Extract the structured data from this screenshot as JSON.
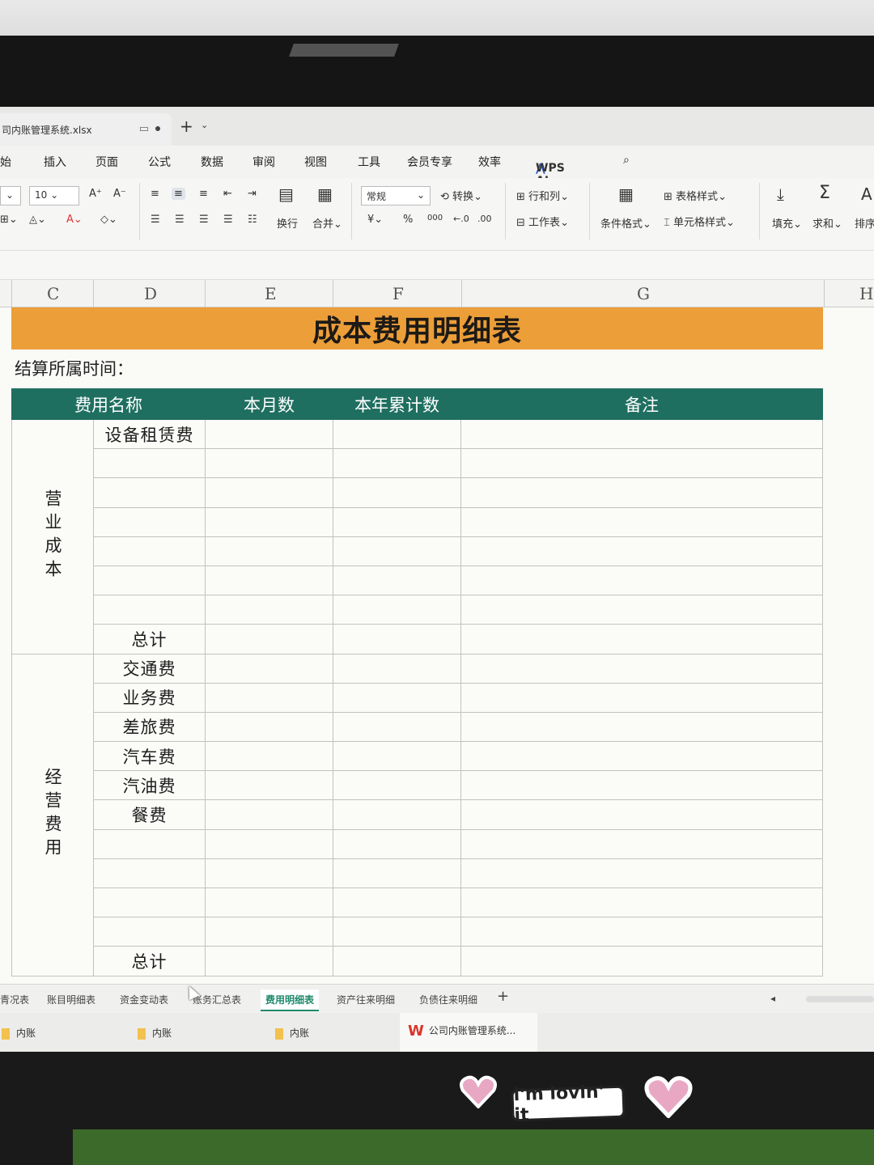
{
  "window": {
    "file_tab": "司内账管理系统.xlsx",
    "new_tab": "+"
  },
  "menu": {
    "items": [
      "始",
      "插入",
      "页面",
      "公式",
      "数据",
      "审阅",
      "视图",
      "工具",
      "会员专享",
      "效率"
    ],
    "ai_label": "WPS AI"
  },
  "ribbon": {
    "font_size": "10",
    "number_format": "常规",
    "wrap_label": "换行",
    "merge_label": "合并",
    "convert_label": "转换",
    "rowcol_label": "行和列",
    "worksheet_label": "工作表",
    "cond_format_label": "条件格式",
    "table_style_label": "表格样式",
    "cell_style_label": "单元格样式",
    "fill_label": "填充",
    "sum_label": "求和",
    "sort_label": "排序",
    "currency_symbol": "¥",
    "percent_symbol": "%",
    "thousands_symbol": "000"
  },
  "columns": [
    "C",
    "D",
    "E",
    "F",
    "G",
    "H"
  ],
  "sheet": {
    "title": "成本费用明细表",
    "period_label": "结算所属时间：",
    "headers": {
      "name": "费用名称",
      "month": "本月数",
      "ytd": "本年累计数",
      "remark": "备注"
    },
    "groups": [
      {
        "label": "营业成本",
        "items": [
          "设备租赁费",
          "",
          "",
          "",
          "",
          "",
          "",
          "总计"
        ]
      },
      {
        "label": "经营费用",
        "items": [
          "交通费",
          "业务费",
          "差旅费",
          "汽车费",
          "汽油费",
          "餐费",
          "",
          "",
          "",
          "",
          "总计"
        ]
      }
    ]
  },
  "sheet_tabs": {
    "items": [
      "青况表",
      "账目明细表",
      "资金变动表",
      "账务汇总表",
      "费用明细表",
      "资产往来明细",
      "负债往来明细"
    ],
    "active": "费用明细表",
    "add": "+"
  },
  "taskbar": {
    "items": [
      "内账",
      "内账",
      "内账"
    ],
    "active_app": "公司内账管理系统..."
  },
  "sticker": {
    "text": "i'm lovin' it"
  }
}
